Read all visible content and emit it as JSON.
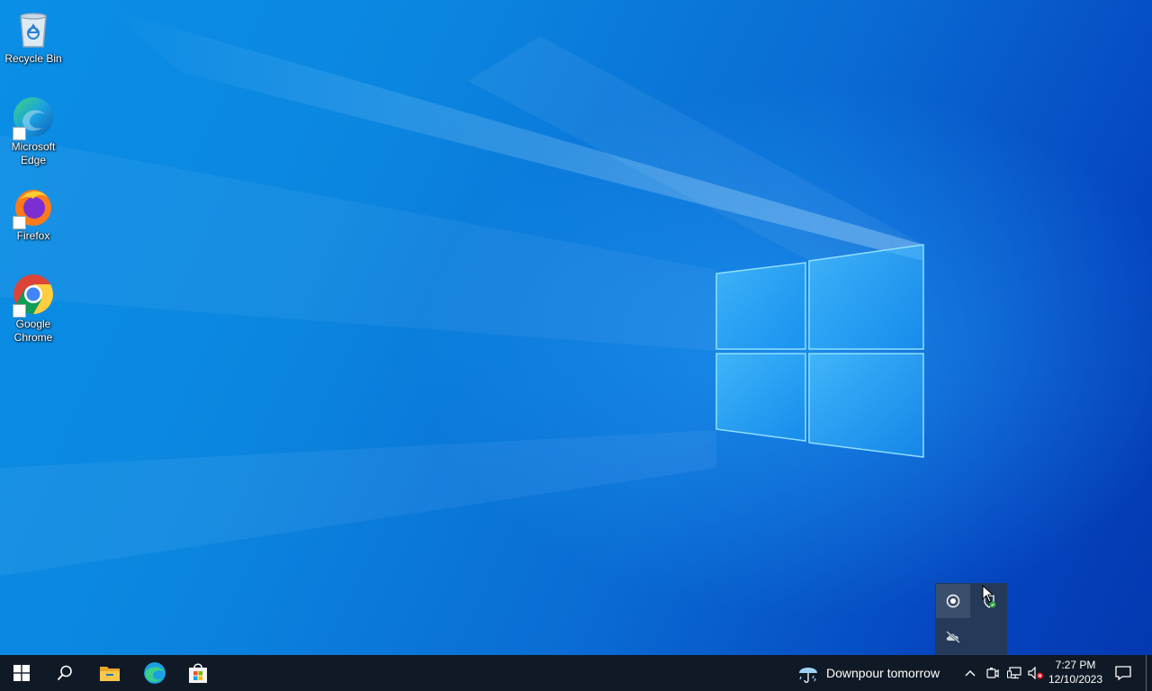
{
  "desktop": {
    "icons": [
      {
        "label": "Recycle Bin",
        "icon": "recycle-bin-icon"
      },
      {
        "label": "Microsoft Edge",
        "icon": "edge-icon"
      },
      {
        "label": "Firefox",
        "icon": "firefox-icon"
      },
      {
        "label": "Google Chrome",
        "icon": "chrome-icon"
      }
    ]
  },
  "tray_overflow": {
    "items": [
      "record-icon",
      "defender-security-icon",
      "onedrive-offline-icon"
    ]
  },
  "taskbar": {
    "start": "windows-start-icon",
    "pinned": [
      "search-icon",
      "file-explorer-icon",
      "edge-icon",
      "microsoft-store-icon"
    ],
    "weather": {
      "text": "Downpour tomorrow",
      "icon": "umbrella-rain-icon"
    },
    "tray": [
      "chevron-up-icon",
      "meet-now-icon",
      "network-icon",
      "volume-muted-icon"
    ],
    "clock": {
      "time": "7:27 PM",
      "date": "12/10/2023"
    },
    "notifications": "notification-icon"
  },
  "colors": {
    "taskbar_bg": "#101a26",
    "desktop_accent": "#0a8fe6",
    "logo": "#5cc8ff"
  }
}
